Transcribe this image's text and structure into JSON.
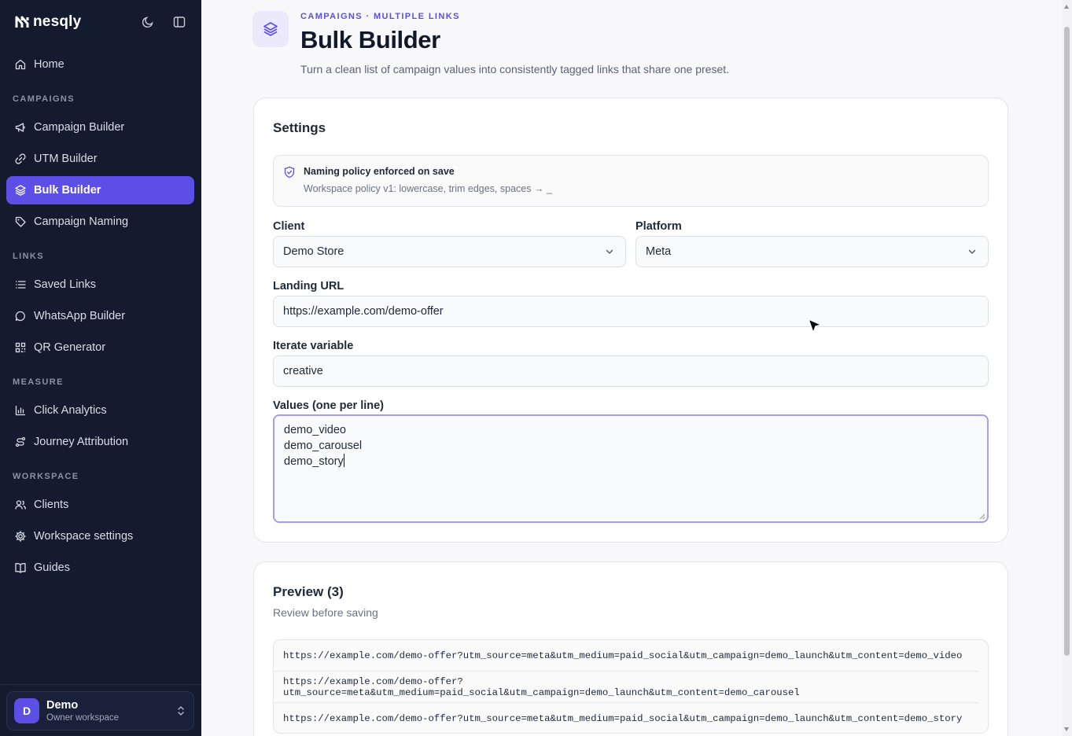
{
  "brand": {
    "name": "nesqly"
  },
  "sidebar": {
    "items": [
      {
        "label": "Home",
        "icon": "home-icon"
      },
      {
        "section": "CAMPAIGNS"
      },
      {
        "label": "Campaign Builder",
        "icon": "megaphone-icon"
      },
      {
        "label": "UTM Builder",
        "icon": "link-icon"
      },
      {
        "label": "Bulk Builder",
        "icon": "layers-icon",
        "active": true
      },
      {
        "label": "Campaign Naming",
        "icon": "tag-icon"
      },
      {
        "section": "LINKS"
      },
      {
        "label": "Saved Links",
        "icon": "list-icon"
      },
      {
        "label": "WhatsApp Builder",
        "icon": "chat-icon"
      },
      {
        "label": "QR Generator",
        "icon": "qr-icon"
      },
      {
        "section": "MEASURE"
      },
      {
        "label": "Click Analytics",
        "icon": "bar-chart-icon"
      },
      {
        "label": "Journey Attribution",
        "icon": "route-icon"
      },
      {
        "section": "WORKSPACE"
      },
      {
        "label": "Clients",
        "icon": "users-icon"
      },
      {
        "label": "Workspace settings",
        "icon": "gear-icon"
      },
      {
        "label": "Guides",
        "icon": "book-icon"
      }
    ],
    "user": {
      "initial": "D",
      "name": "Demo",
      "subtitle": "Owner workspace"
    }
  },
  "header": {
    "eyebrow": "CAMPAIGNS · MULTIPLE LINKS",
    "title": "Bulk Builder",
    "description": "Turn a clean list of campaign values into consistently tagged links that share one preset."
  },
  "settings": {
    "title": "Settings",
    "policy": {
      "title": "Naming policy enforced on save",
      "detail": "Workspace policy v1: lowercase, trim edges, spaces → _"
    },
    "client": {
      "label": "Client",
      "value": "Demo Store"
    },
    "platform": {
      "label": "Platform",
      "value": "Meta"
    },
    "landing_url": {
      "label": "Landing URL",
      "value": "https://example.com/demo-offer"
    },
    "iterate_variable": {
      "label": "Iterate variable",
      "value": "creative"
    },
    "values": {
      "label": "Values (one per line)",
      "lines": [
        "demo_video",
        "demo_carousel",
        "demo_story"
      ]
    }
  },
  "preview": {
    "title": "Preview (3)",
    "subtitle": "Review before saving",
    "links": [
      "https://example.com/demo-offer?utm_source=meta&utm_medium=paid_social&utm_campaign=demo_launch&utm_content=demo_video",
      "https://example.com/demo-offer?utm_source=meta&utm_medium=paid_social&utm_campaign=demo_launch&utm_content=demo_carousel",
      "https://example.com/demo-offer?utm_source=meta&utm_medium=paid_social&utm_campaign=demo_launch&utm_content=demo_story"
    ]
  },
  "colors": {
    "accent": "#5b4fe6",
    "sidebar_bg": "#141b2e"
  }
}
